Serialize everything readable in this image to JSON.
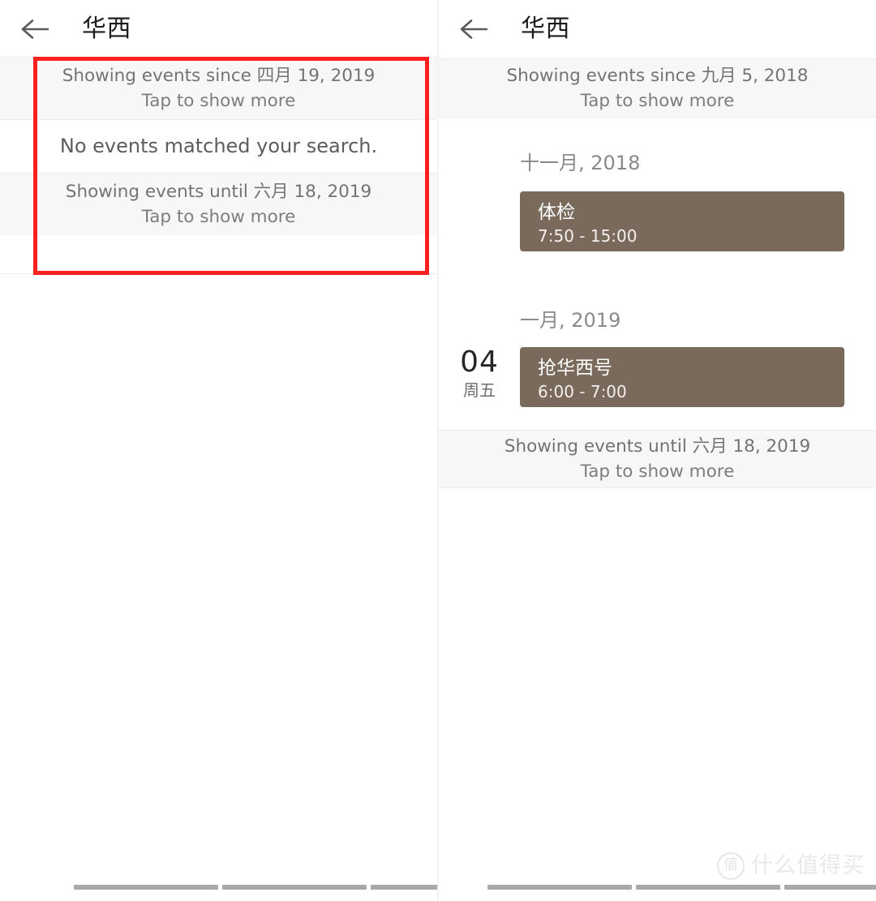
{
  "meta": {
    "accent_red": "#fb2020",
    "event_chip_color": "#7a6a5c",
    "band_gray": "#f7f7f7"
  },
  "left_panel": {
    "appbar": {
      "back_icon": "arrow-left-icon",
      "title": "华西"
    },
    "range_top": {
      "line1": "Showing events since 四月 19, 2019",
      "line2": "Tap to show more"
    },
    "empty_notice": "No events matched your search.",
    "range_bottom": {
      "line1": "Showing events until 六月 18, 2019",
      "line2": "Tap to show more"
    },
    "navbar": {
      "keys": [
        "recent-apps-key",
        "home-key",
        "back-key"
      ]
    }
  },
  "right_panel": {
    "appbar": {
      "back_icon": "arrow-left-icon",
      "title": "华西"
    },
    "range_top": {
      "line1": "Showing events since 九月 5, 2018",
      "line2": "Tap to show more"
    },
    "groups": [
      {
        "month_label": "十一月, 2018",
        "rows": [
          {
            "day_number": "",
            "day_week": "",
            "event_title": "体检",
            "event_time": "7:50 - 15:00"
          }
        ]
      },
      {
        "month_label": "一月, 2019",
        "rows": [
          {
            "day_number": "04",
            "day_week": "周五",
            "event_title": "抢华西号",
            "event_time": "6:00 - 7:00"
          }
        ]
      }
    ],
    "range_bottom": {
      "line1": "Showing events until 六月 18, 2019",
      "line2": "Tap to show more"
    },
    "navbar": {
      "keys": [
        "recent-apps-key",
        "home-key",
        "back-key"
      ]
    }
  },
  "watermark": {
    "badge": "值",
    "text": "什么值得买"
  }
}
